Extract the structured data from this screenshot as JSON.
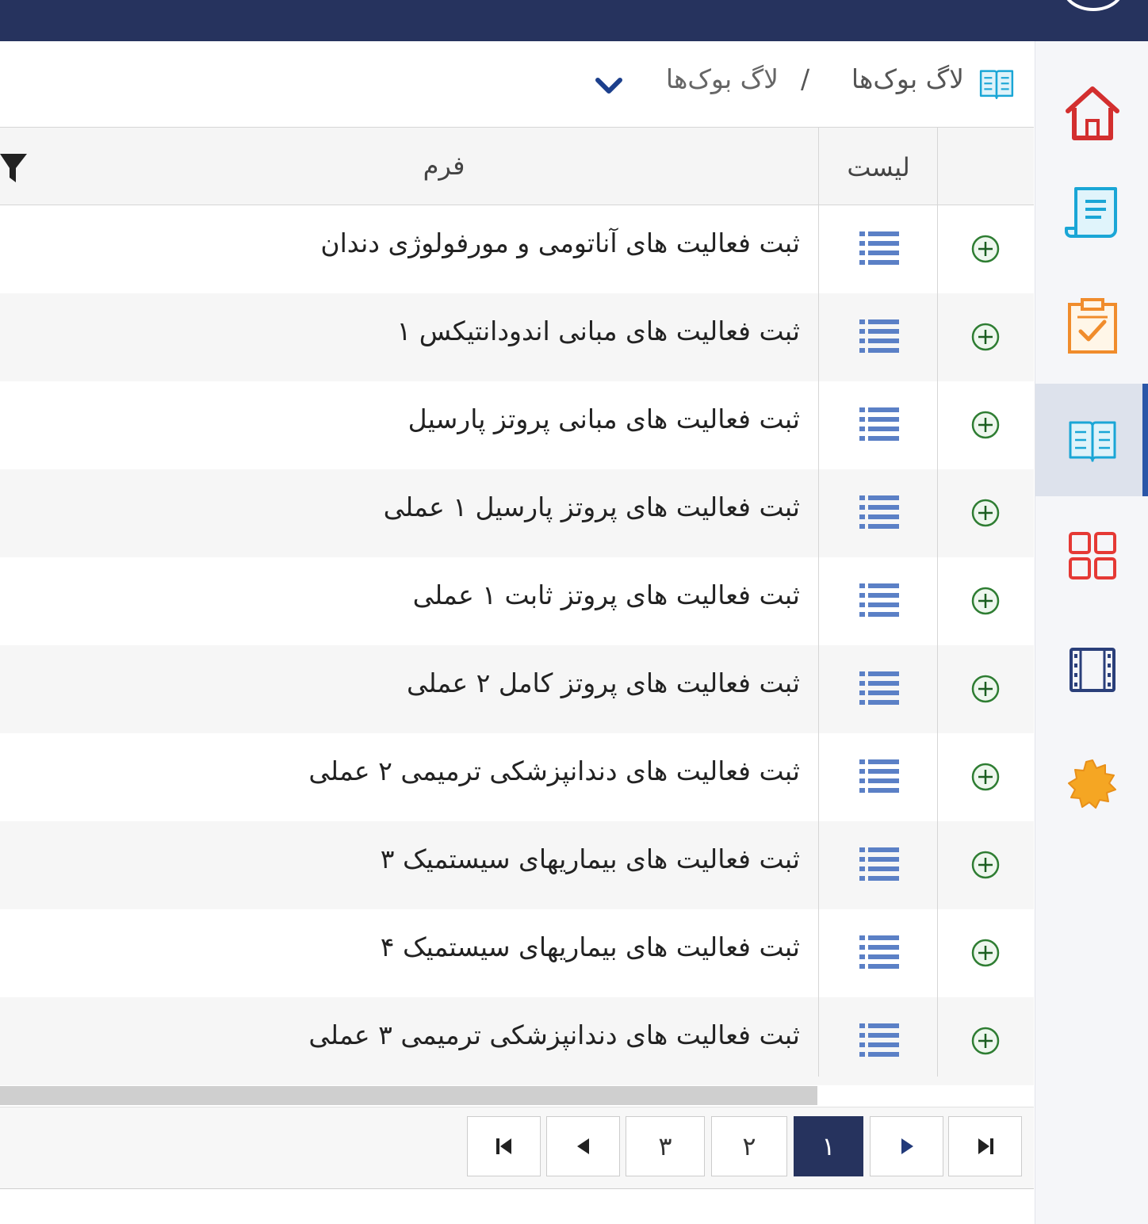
{
  "breadcrumb": {
    "root": "لاگ بوک‌ها",
    "separator": "/",
    "current": "لاگ بوک‌ها"
  },
  "table": {
    "headers": {
      "list": "لیست",
      "form": "فرم"
    },
    "rows": [
      "ثبت فعالیت های آناتومی و مورفولوژی دندان",
      "ثبت فعالیت های مبانی اندودانتیکس ۱",
      "ثبت فعالیت های مبانی پروتز پارسیل",
      "ثبت فعالیت های پروتز پارسیل ۱ عملی",
      "ثبت فعالیت های پروتز ثابت ۱ عملی",
      "ثبت فعالیت های پروتز کامل ۲ عملی",
      "ثبت فعالیت های دندانپزشکی ترمیمی ۲ عملی",
      "ثبت فعالیت های بیماریهای سیستمیک ۳",
      "ثبت فعالیت های بیماریهای سیستمیک ۴",
      "ثبت فعالیت های دندانپزشکی ترمیمی ۳ عملی"
    ]
  },
  "pagination": {
    "pages": [
      "۱",
      "۲",
      "۳"
    ],
    "current": "۱"
  },
  "sidebar_icons": [
    "home-icon",
    "scroll-document-icon",
    "clipboard-check-icon",
    "open-book-icon",
    "grid-icon",
    "film-icon",
    "badge-icon"
  ],
  "colors": {
    "topbar": "#26335e",
    "accent_blue": "#2a56a8",
    "active_page": "#26335e",
    "plus_green": "#2e7d32",
    "list_icon_blue": "#5b80c6"
  }
}
